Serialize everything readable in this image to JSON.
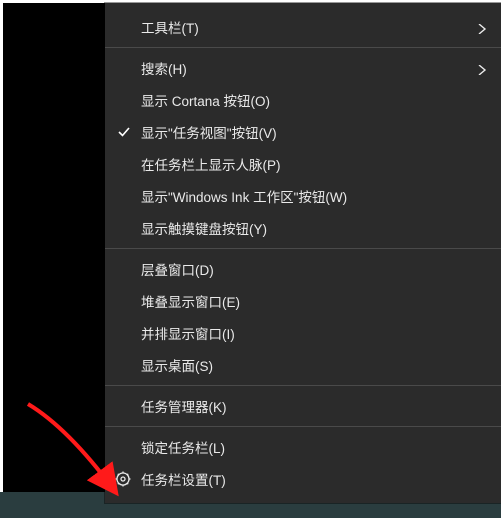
{
  "menu": {
    "items": [
      {
        "label": "工具栏(T)",
        "submenu": true
      },
      {
        "label": "搜索(H)",
        "submenu": true
      },
      {
        "label": "显示 Cortana 按钮(O)"
      },
      {
        "label": "显示\"任务视图\"按钮(V)",
        "checked": true
      },
      {
        "label": "在任务栏上显示人脉(P)"
      },
      {
        "label": "显示\"Windows Ink 工作区\"按钮(W)"
      },
      {
        "label": "显示触摸键盘按钮(Y)"
      },
      {
        "label": "层叠窗口(D)"
      },
      {
        "label": "堆叠显示窗口(E)"
      },
      {
        "label": "并排显示窗口(I)"
      },
      {
        "label": "显示桌面(S)"
      },
      {
        "label": "任务管理器(K)"
      },
      {
        "label": "锁定任务栏(L)"
      },
      {
        "label": "任务栏设置(T)",
        "icon": "gear"
      }
    ]
  }
}
